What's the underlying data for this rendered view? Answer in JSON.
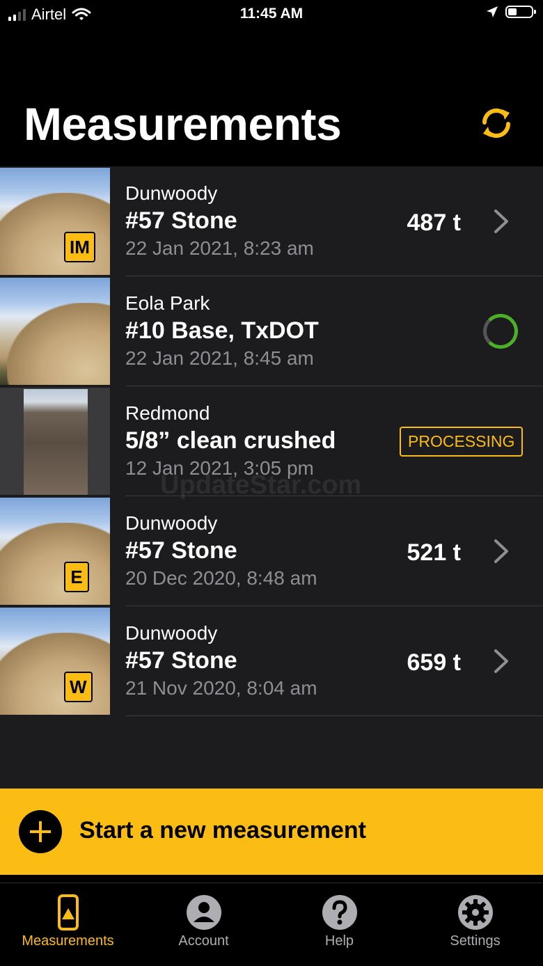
{
  "status_bar": {
    "carrier": "Airtel",
    "time": "11:45 AM"
  },
  "header": {
    "title": "Measurements"
  },
  "measurements": [
    {
      "site": "Dunwoody",
      "material": "#57 Stone",
      "date": "22 Jan 2021, 8:23 am",
      "tonnage": "487 t",
      "badge": "IM",
      "state": "complete"
    },
    {
      "site": "Eola Park",
      "material": "#10 Base, TxDOT",
      "date": "22 Jan 2021, 8:45 am",
      "state": "loading"
    },
    {
      "site": "Redmond",
      "material": "5/8” clean crushed",
      "date": "12 Jan 2021, 3:05 pm",
      "status_label": "PROCESSING",
      "state": "processing"
    },
    {
      "site": "Dunwoody",
      "material": "#57 Stone",
      "date": "20 Dec 2020, 8:48 am",
      "tonnage": "521 t",
      "badge": "E",
      "state": "complete"
    },
    {
      "site": "Dunwoody",
      "material": "#57 Stone",
      "date": "21 Nov 2020, 8:04 am",
      "tonnage": "659 t",
      "badge": "W",
      "state": "complete"
    }
  ],
  "cta": {
    "label": "Start a new measurement"
  },
  "tabs": [
    {
      "label": "Measurements",
      "icon": "phone-icon",
      "active": true
    },
    {
      "label": "Account",
      "icon": "person-icon",
      "active": false
    },
    {
      "label": "Help",
      "icon": "question-icon",
      "active": false
    },
    {
      "label": "Settings",
      "icon": "gear-icon",
      "active": false
    }
  ],
  "watermark": "UpdateStar.com",
  "colors": {
    "accent": "#fbbd14",
    "list_bg": "#1c1c1e",
    "muted": "#8e8e93",
    "spinner": "#4caf2a"
  }
}
